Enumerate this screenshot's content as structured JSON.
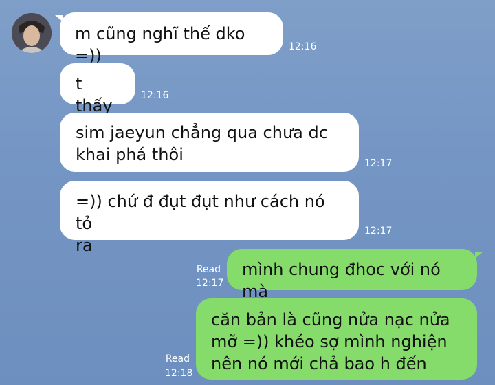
{
  "contact": {
    "avatar_icon": "person-avatar-icon"
  },
  "messages": [
    {
      "text": "m cũng nghĩ thế dko =))",
      "time": "12:16"
    },
    {
      "text": "t thấy",
      "time": "12:16"
    },
    {
      "line1": "sim jaeyun chẳng qua chưa dc",
      "line2": "khai phá thôi",
      "time": "12:17"
    },
    {
      "line1": "=)) chứ đ đụt đụt như cách nó tỏ",
      "line2": "ra",
      "time": "12:17"
    },
    {
      "text": "mình chung đhoc với nó mà",
      "status": "Read",
      "time": "12:17"
    },
    {
      "line1": "căn bản là cũng nửa nạc nửa",
      "line2": "mỡ =)) khéo sợ mình nghiện",
      "line3": "nên nó mới chả bao h đến",
      "status": "Read",
      "time": "12:18"
    }
  ],
  "colors": {
    "incoming_bubble": "#ffffff",
    "outgoing_bubble": "#86dc6a",
    "background": "#7596c4"
  }
}
